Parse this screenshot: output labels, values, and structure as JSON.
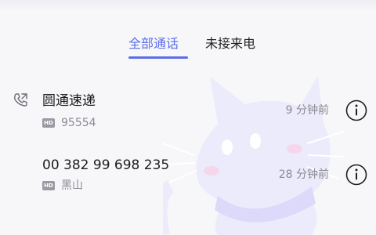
{
  "tabs": {
    "all_calls": "全部通话",
    "missed_calls": "未接来电"
  },
  "calls": [
    {
      "name": "圆通速递",
      "detail": "95554",
      "time": "9 分钟前",
      "call_type_icon": "outgoing-call-icon",
      "hd": "HD"
    },
    {
      "name": "00 382 99 698 235",
      "detail": "黑山",
      "time": "28 分钟前",
      "hd": "HD"
    }
  ],
  "colors": {
    "accent": "#5b6ee8",
    "text_primary": "#1c1c1c",
    "text_secondary": "#8a8a92",
    "background": "#f7f7fa"
  }
}
